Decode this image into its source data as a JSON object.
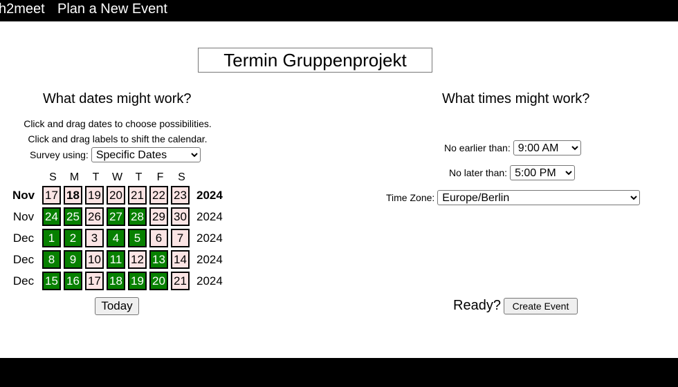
{
  "header": {
    "brand": "h2meet",
    "nav_plan": "Plan a New Event"
  },
  "event_name": "Termin Gruppenprojekt",
  "dates": {
    "heading": "What dates might work?",
    "instruction_1": "Click and drag dates to choose possibilities.",
    "instruction_2": "Click and drag labels to shift the calendar.",
    "survey_label": "Survey using:",
    "survey_value": "Specific Dates",
    "weekdays": [
      "S",
      "M",
      "T",
      "W",
      "T",
      "F",
      "S"
    ],
    "weeks": [
      {
        "month": "Nov",
        "year": "2024",
        "bold": true,
        "days": [
          {
            "d": "17",
            "sel": false
          },
          {
            "d": "18",
            "sel": false,
            "bold": true
          },
          {
            "d": "19",
            "sel": false
          },
          {
            "d": "20",
            "sel": false
          },
          {
            "d": "21",
            "sel": false
          },
          {
            "d": "22",
            "sel": false
          },
          {
            "d": "23",
            "sel": false
          }
        ]
      },
      {
        "month": "Nov",
        "year": "2024",
        "bold": false,
        "days": [
          {
            "d": "24",
            "sel": true
          },
          {
            "d": "25",
            "sel": true
          },
          {
            "d": "26",
            "sel": false
          },
          {
            "d": "27",
            "sel": true
          },
          {
            "d": "28",
            "sel": true
          },
          {
            "d": "29",
            "sel": false
          },
          {
            "d": "30",
            "sel": false
          }
        ]
      },
      {
        "month": "Dec",
        "year": "2024",
        "bold": false,
        "days": [
          {
            "d": "1",
            "sel": true
          },
          {
            "d": "2",
            "sel": true
          },
          {
            "d": "3",
            "sel": false
          },
          {
            "d": "4",
            "sel": true
          },
          {
            "d": "5",
            "sel": true
          },
          {
            "d": "6",
            "sel": false
          },
          {
            "d": "7",
            "sel": false
          }
        ]
      },
      {
        "month": "Dec",
        "year": "2024",
        "bold": false,
        "days": [
          {
            "d": "8",
            "sel": true
          },
          {
            "d": "9",
            "sel": true
          },
          {
            "d": "10",
            "sel": false
          },
          {
            "d": "11",
            "sel": true
          },
          {
            "d": "12",
            "sel": false
          },
          {
            "d": "13",
            "sel": true
          },
          {
            "d": "14",
            "sel": false
          }
        ]
      },
      {
        "month": "Dec",
        "year": "2024",
        "bold": false,
        "days": [
          {
            "d": "15",
            "sel": true
          },
          {
            "d": "16",
            "sel": true
          },
          {
            "d": "17",
            "sel": false
          },
          {
            "d": "18",
            "sel": true
          },
          {
            "d": "19",
            "sel": true
          },
          {
            "d": "20",
            "sel": true
          },
          {
            "d": "21",
            "sel": false
          }
        ]
      }
    ],
    "today_label": "Today"
  },
  "times": {
    "heading": "What times might work?",
    "earliest_label": "No earlier than:",
    "earliest_value": "9:00 AM",
    "latest_label": "No later than:",
    "latest_value": "5:00 PM",
    "timezone_label": "Time Zone:",
    "timezone_value": "Europe/Berlin"
  },
  "footer": {
    "ready_label": "Ready?",
    "create_label": "Create Event"
  },
  "colors": {
    "selected": "#078000",
    "unselected": "#fbe4e4",
    "bar": "#000000"
  }
}
